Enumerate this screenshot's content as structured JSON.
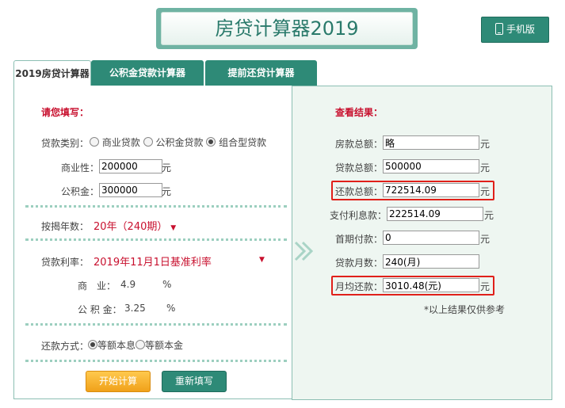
{
  "header": {
    "title": "房贷计算器2019",
    "mobile_button": "手机版"
  },
  "tabs": [
    {
      "label": "2019房贷计算器",
      "active": true
    },
    {
      "label": "公积金贷款计算器",
      "active": false
    },
    {
      "label": "提前还贷计算器",
      "active": false
    }
  ],
  "form": {
    "section_title": "请您填写：",
    "loan_type": {
      "label": "贷款类别：",
      "options": [
        "商业贷款",
        "公积金贷款",
        "组合型贷款"
      ],
      "selected": "组合型贷款"
    },
    "commercial": {
      "label": "商业性：",
      "value": "200000",
      "unit": "元"
    },
    "fund": {
      "label": "公积金：",
      "value": "300000",
      "unit": "元"
    },
    "years": {
      "label": "按揭年数：",
      "value": "20年（240期）"
    },
    "rate": {
      "label": "贷款利率：",
      "value": "2019年11月1日基准利率",
      "commercial_label": "商　业：",
      "commercial_value": "4.9",
      "fund_label": "公 积 金：",
      "fund_value": "3.25",
      "unit": "%"
    },
    "repay_method": {
      "label": "还款方式：",
      "options": [
        "等额本息",
        "等额本金"
      ],
      "selected": "等额本息"
    },
    "start_button": "开始计算",
    "reset_button": "重新填写"
  },
  "results": {
    "section_title": "查看结果：",
    "house_total": {
      "label": "房款总额：",
      "value": "略",
      "unit": "元"
    },
    "loan_total": {
      "label": "贷款总额：",
      "value": "500000",
      "unit": "元"
    },
    "repay_total": {
      "label": "还款总额：",
      "value": "722514.09",
      "unit": "元"
    },
    "interest": {
      "label": "支付利息款：",
      "value": "222514.09",
      "unit": "元"
    },
    "down_payment": {
      "label": "首期付款：",
      "value": "0",
      "unit": "元"
    },
    "months": {
      "label": "贷款月数：",
      "value": "240(月)"
    },
    "monthly": {
      "label": "月均还款：",
      "value": "3010.48(元)",
      "unit": "元"
    },
    "note": "*以上结果仅供参考"
  },
  "colors": {
    "accent": "#2e8a77",
    "highlight": "#e0201a",
    "red_text": "#c8102e"
  }
}
